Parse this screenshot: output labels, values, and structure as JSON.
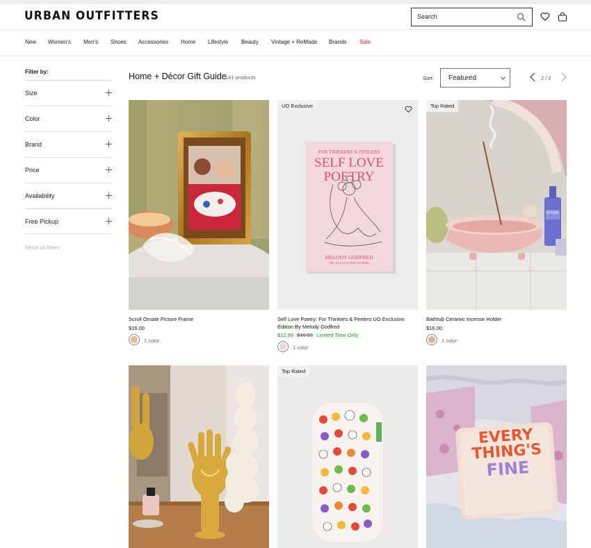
{
  "header": {
    "logo": "URBAN OUTFITTERS",
    "search_placeholder": "Search"
  },
  "nav": {
    "items": [
      "New",
      "Women's",
      "Men's",
      "Shoes",
      "Accessories",
      "Home",
      "Lifestyle",
      "Beauty",
      "Vintage + ReMade",
      "Brands",
      "Sale"
    ]
  },
  "filters": {
    "title": "Filter by:",
    "groups": [
      "Size",
      "Color",
      "Brand",
      "Price",
      "Availability",
      "Free Pickup"
    ],
    "reset": "Reset all filters"
  },
  "main": {
    "title": "Home + Décor Gift Guide",
    "count": "141 products",
    "sort_label": "Sort:",
    "sort_value": "Featured",
    "pager": "2 / 2"
  },
  "products": [
    {
      "name": "Scroll Ornate Picture Frame",
      "price": "$16.00",
      "badge": "",
      "swatch_color": "#d9bf93",
      "colors": "1 color"
    },
    {
      "name": "Self Love Poetry: For Thinkers & Feelers UO Exclusive Edition By Melody Godfred",
      "badge": "UO Exclusive",
      "sale_price": "$12.99",
      "orig_price": "$16.99",
      "promo": "Limited Time Only",
      "swatch_color": "#efd6dc",
      "colors": "1 color",
      "book": {
        "kicker": "FOR THINKERS & FEELERS",
        "title_1": "SELF LOVE",
        "title_2": "POETRY",
        "author": "MELODY GODFRED",
        "footer": "THE SELF LOVE PHILOSOPHER"
      }
    },
    {
      "name": "Bathtub Ceramic Incense Holder",
      "price": "$16.00",
      "badge": "Top Rated",
      "swatch_color": "#d3b2ae",
      "colors": "1 color",
      "bottle_label": "BYOMA"
    },
    {
      "name": "",
      "badge": ""
    },
    {
      "name": "",
      "badge": "Top Rated"
    },
    {
      "name": "",
      "badge": "",
      "pillow_text": [
        "EVERY",
        "THING'S",
        "FINE"
      ]
    }
  ],
  "colors": {
    "sale_red": "#d62828",
    "promo_green": "#2e8b2e"
  }
}
